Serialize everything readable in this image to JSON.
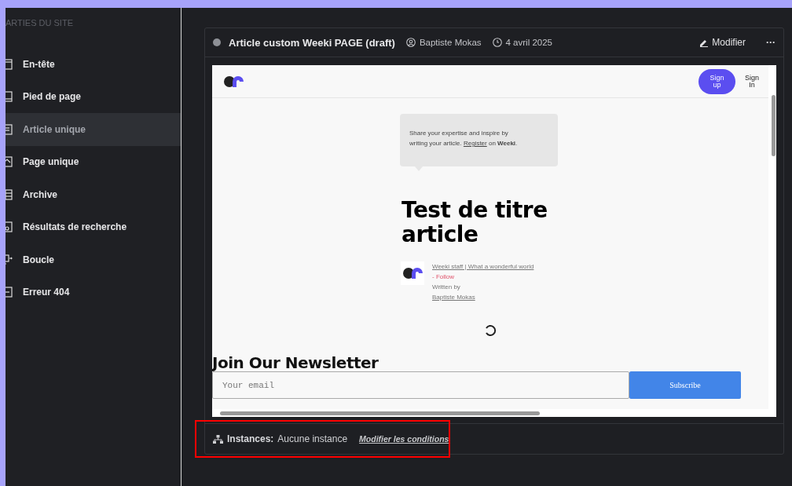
{
  "sidebar": {
    "heading": "ARTIES DU SITE",
    "items": [
      {
        "label": "En-tête",
        "selected": false
      },
      {
        "label": "Pied de page",
        "selected": false
      },
      {
        "label": "Article unique",
        "selected": true
      },
      {
        "label": "Page unique",
        "selected": false
      },
      {
        "label": "Archive",
        "selected": false
      },
      {
        "label": "Résultats de recherche",
        "selected": false
      },
      {
        "label": "Boucle",
        "selected": false
      },
      {
        "label": "Erreur 404",
        "selected": false
      }
    ]
  },
  "card": {
    "title": "Article custom Weeki PAGE (draft)",
    "author": "Baptiste Mokas",
    "date": "4 avril 2025",
    "edit_button": "Modifier",
    "more_button": "···",
    "preview": {
      "sign_up": "Sign up",
      "sign_in": "Sign In",
      "callout_before": "Share your expertise and inspire by writing your article.",
      "callout_link": "Register",
      "callout_after": "on **Weeki**.",
      "title": "Test de titre article",
      "author_line": "Weeki staff | What a wonderful world",
      "follow": "- Follow",
      "written_by": "Written by",
      "author_name": "Baptiste Mokas",
      "newsletter_title": "Join Our Newsletter",
      "email_placeholder": "Your email",
      "subscribe": "Subscribe"
    },
    "footer": {
      "label": "Instances:",
      "value": "Aucune instance",
      "link": "Modifier les conditions"
    }
  },
  "highlight": {
    "shown": true
  }
}
